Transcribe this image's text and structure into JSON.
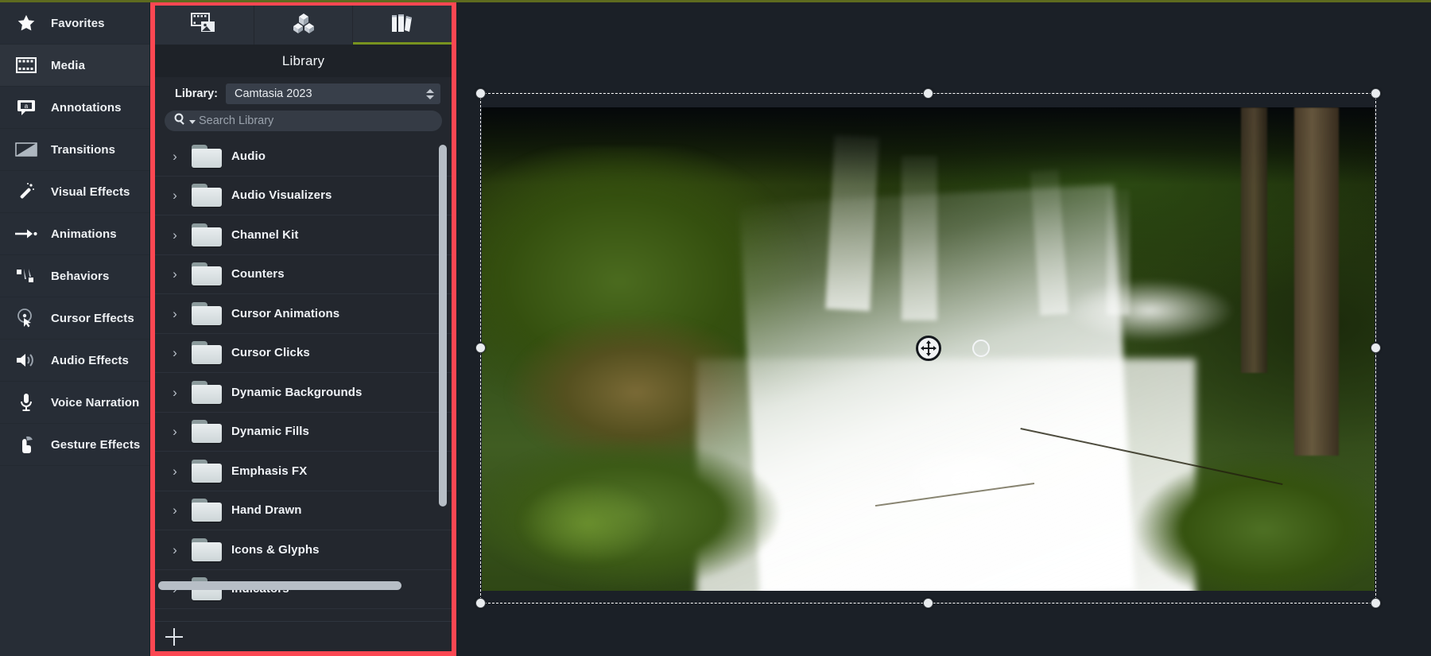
{
  "app": {
    "accent_green": "#78931f",
    "highlight_red": "#fc4752",
    "bg": "#1b2027"
  },
  "sidebar": {
    "items": [
      {
        "label": "Favorites",
        "icon": "star-icon",
        "selected": false
      },
      {
        "label": "Media",
        "icon": "film-strip-icon",
        "selected": true
      },
      {
        "label": "Annotations",
        "icon": "callout-icon",
        "selected": false
      },
      {
        "label": "Transitions",
        "icon": "transition-icon",
        "selected": false
      },
      {
        "label": "Visual Effects",
        "icon": "magic-wand-icon",
        "selected": false
      },
      {
        "label": "Animations",
        "icon": "arrow-motion-icon",
        "selected": false
      },
      {
        "label": "Behaviors",
        "icon": "behaviors-icon",
        "selected": false
      },
      {
        "label": "Cursor Effects",
        "icon": "cursor-target-icon",
        "selected": false
      },
      {
        "label": "Audio Effects",
        "icon": "speaker-icon",
        "selected": false
      },
      {
        "label": "Voice Narration",
        "icon": "microphone-icon",
        "selected": false
      },
      {
        "label": "Gesture Effects",
        "icon": "hand-pointer-icon",
        "selected": false
      }
    ]
  },
  "library_panel": {
    "tabs": [
      {
        "name": "media-tab",
        "icon": "media-film-photo-icon",
        "active": false
      },
      {
        "name": "assets-tab",
        "icon": "cubes-icon",
        "active": false
      },
      {
        "name": "library-tab",
        "icon": "books-icon",
        "active": true
      }
    ],
    "title": "Library",
    "library_select": {
      "label": "Library:",
      "value": "Camtasia 2023",
      "stepper_icon": "up-down-stepper-icon"
    },
    "search": {
      "placeholder": "Search Library",
      "icon": "search-icon",
      "dropdown_icon": "caret-down-icon"
    },
    "folders": [
      {
        "name": "Audio"
      },
      {
        "name": "Audio Visualizers"
      },
      {
        "name": "Channel Kit"
      },
      {
        "name": "Counters"
      },
      {
        "name": "Cursor Animations"
      },
      {
        "name": "Cursor Clicks"
      },
      {
        "name": "Dynamic Backgrounds"
      },
      {
        "name": "Dynamic Fills"
      },
      {
        "name": "Emphasis FX"
      },
      {
        "name": "Hand Drawn"
      },
      {
        "name": "Icons & Glyphs"
      },
      {
        "name": "Indicators"
      }
    ],
    "footer": {
      "add_label": "+",
      "add_icon": "plus-icon"
    }
  },
  "canvas": {
    "media_name": "waterfall-photo",
    "selection": {
      "move_icon": "move-four-arrows-icon",
      "rotate_icon": "rotate-handle-icon",
      "handles": [
        "top-left",
        "top-center",
        "top-right",
        "middle-left",
        "middle-right",
        "bottom-left",
        "bottom-center",
        "bottom-right"
      ]
    }
  }
}
